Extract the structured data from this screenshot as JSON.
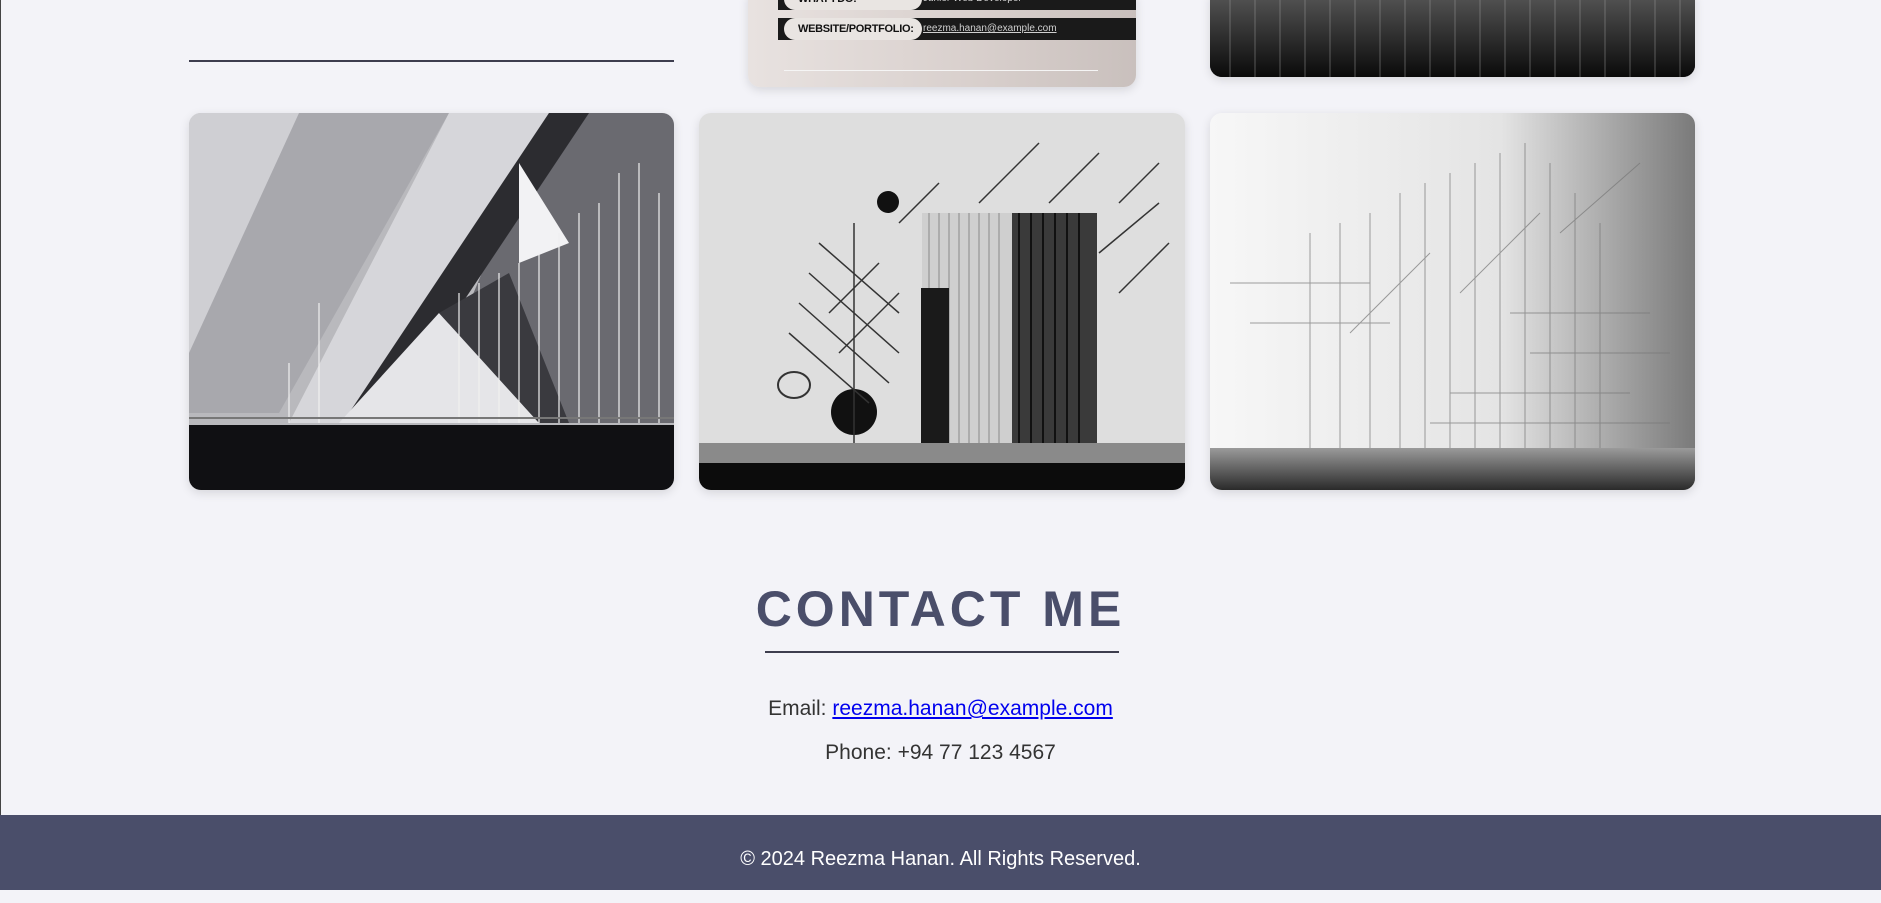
{
  "portfolio_cards": {
    "business_card": {
      "what_i_do_label": "WHAT I DO:",
      "what_i_do_value": "Junior Web Developer",
      "website_label": "WEBSITE/PORTFOLIO:",
      "website_value": "reezma.hanan@example.com"
    },
    "images": [
      {
        "alt": "abstract-geometric-art-1"
      },
      {
        "alt": "abstract-geometric-art-2"
      },
      {
        "alt": "abstract-geometric-art-3"
      }
    ]
  },
  "contact": {
    "title": "CONTACT ME",
    "email_label": "Email:",
    "email_value": "reezma.hanan@example.com",
    "phone_text": "Phone: +94 77 123 4567"
  },
  "footer": {
    "text": "© 2024 Reezma Hanan. All Rights Reserved."
  },
  "colors": {
    "background": "#f3f3f8",
    "accent": "#4a4e6a",
    "link": "#0000ee"
  }
}
